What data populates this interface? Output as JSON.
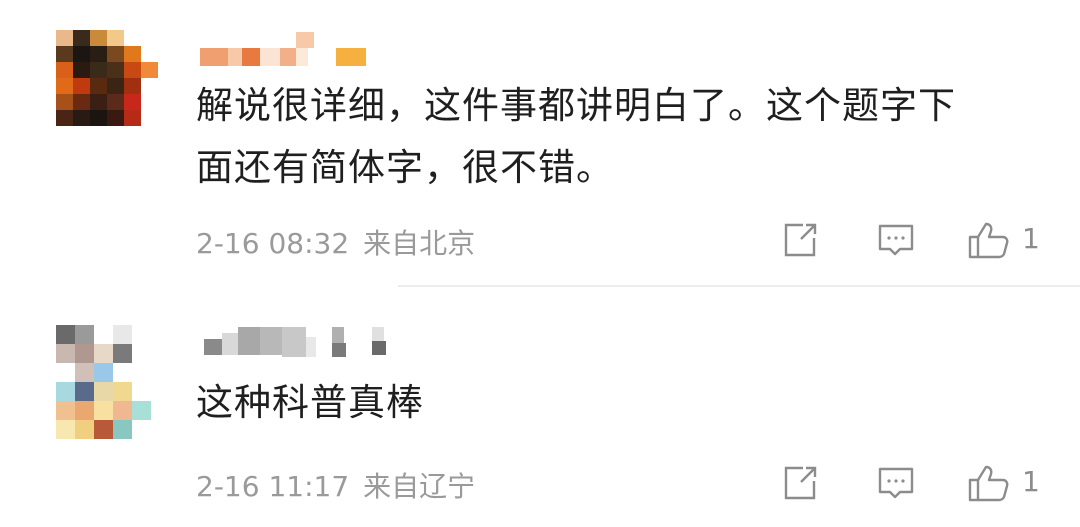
{
  "comments": [
    {
      "text_line1": "解说很详细，这件事都讲明白了。这个题字下",
      "text_line2": "面还有简体字，很不错。",
      "date": "2-16 08:32",
      "location": "来自北京",
      "like_count": "1",
      "icons": [
        "share-icon",
        "reply-icon",
        "thumbs-up-icon"
      ]
    },
    {
      "text_line1": "这种科普真棒",
      "date": "2-16 11:17",
      "location": "来自辽宁",
      "like_count": "1",
      "icons": [
        "share-icon",
        "reply-icon",
        "thumbs-up-icon"
      ]
    }
  ],
  "colors": {
    "text": "#1f1f1f",
    "meta": "#9a9a9a",
    "icon": "#8c8c8c",
    "divider": "#ececec"
  }
}
